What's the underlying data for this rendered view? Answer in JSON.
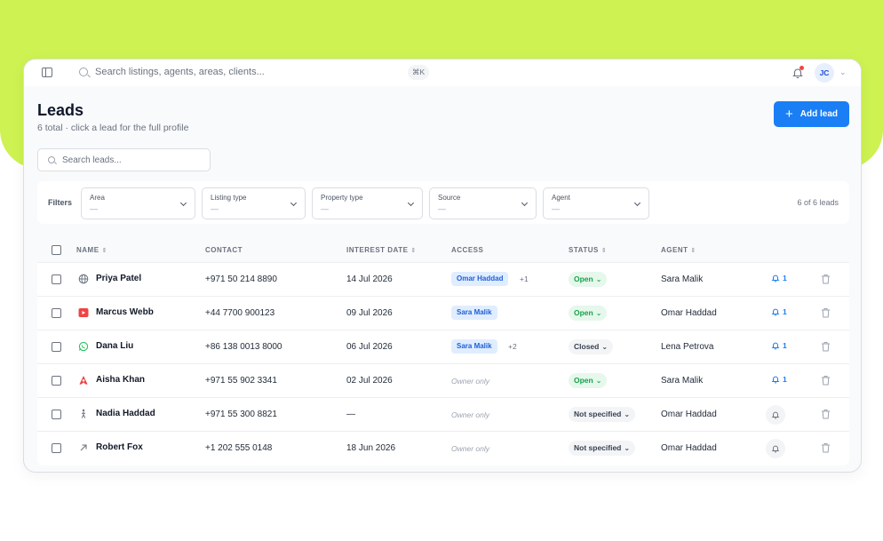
{
  "topbar": {
    "search_placeholder": "Search listings, agents, areas, clients...",
    "shortcut": "⌘K",
    "avatar_initials": "JC"
  },
  "header": {
    "title": "Leads",
    "subtitle": "6 total · click a lead for the full profile",
    "add_button": "Add lead"
  },
  "search": {
    "placeholder": "Search leads..."
  },
  "filters": {
    "label": "Filters",
    "items": [
      {
        "label": "Area",
        "value": "—"
      },
      {
        "label": "Listing type",
        "value": "—"
      },
      {
        "label": "Property type",
        "value": "—"
      },
      {
        "label": "Source",
        "value": "—"
      },
      {
        "label": "Agent",
        "value": "—"
      }
    ],
    "count": "6 of 6 leads"
  },
  "table": {
    "headers": {
      "name": "NAME",
      "contact": "CONTACT",
      "interest_date": "INTEREST DATE",
      "access": "ACCESS",
      "status": "STATUS",
      "agent": "AGENT"
    },
    "rows": [
      {
        "name": "Priya Patel",
        "source_icon": "globe-icon",
        "contact": "+971 50 214 8890",
        "date": "14 Jul 2026",
        "access": "Omar Haddad",
        "access_extra": "+1",
        "status": "Open",
        "agent": "Sara Malik",
        "reminders": "1"
      },
      {
        "name": "Marcus Webb",
        "source_icon": "youtube-icon",
        "contact": "+44 7700 900123",
        "date": "09 Jul 2026",
        "access": "Sara Malik",
        "access_extra": "",
        "status": "Open",
        "agent": "Omar Haddad",
        "reminders": "1"
      },
      {
        "name": "Dana Liu",
        "source_icon": "whatsapp-icon",
        "contact": "+86 138 0013 8000",
        "date": "06 Jul 2026",
        "access": "Sara Malik",
        "access_extra": "+2",
        "status": "Closed",
        "agent": "Lena Petrova",
        "reminders": "1"
      },
      {
        "name": "Aisha Khan",
        "source_icon": "airbnb-icon",
        "contact": "+971 55 902 3341",
        "date": "02 Jul 2026",
        "access": "Owner only",
        "access_extra": "",
        "status": "Open",
        "agent": "Sara Malik",
        "reminders": "1"
      },
      {
        "name": "Nadia Haddad",
        "source_icon": "walk-in-icon",
        "contact": "+971 55 300 8821",
        "date": "—",
        "access": "Owner only",
        "access_extra": "",
        "status": "Not specified",
        "agent": "Omar Haddad",
        "reminders": ""
      },
      {
        "name": "Robert Fox",
        "source_icon": "referral-arrow-icon",
        "contact": "+1 202 555 0148",
        "date": "18 Jun 2026",
        "access": "Owner only",
        "access_extra": "",
        "status": "Not specified",
        "agent": "Omar Haddad",
        "reminders": ""
      }
    ]
  },
  "colors": {
    "background_accent": "#cdf251",
    "primary": "#1a7ef5",
    "status_open": "#16a34a"
  }
}
